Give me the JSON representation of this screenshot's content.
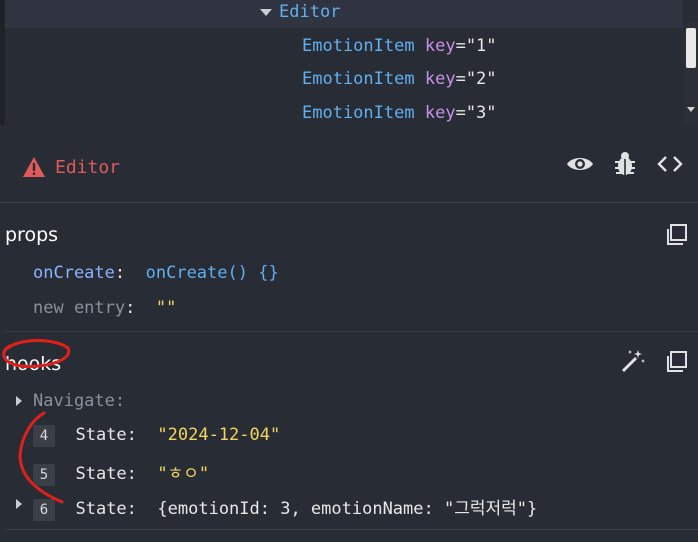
{
  "tree": {
    "parent": "Editor",
    "children": [
      {
        "name": "EmotionItem",
        "key_label": "key",
        "key_value": "\"1\""
      },
      {
        "name": "EmotionItem",
        "key_label": "key",
        "key_value": "\"2\""
      },
      {
        "name": "EmotionItem",
        "key_label": "key",
        "key_value": "\"3\""
      }
    ]
  },
  "selected": {
    "name": "Editor",
    "warning_color": "#e05a5a",
    "icons": [
      "eye-icon",
      "bug-icon",
      "code-icon"
    ]
  },
  "props": {
    "title": "props",
    "rows": [
      {
        "key": "onCreate",
        "sep": ":",
        "value": "onCreate() {}"
      },
      {
        "key": "new entry",
        "sep": ":",
        "value": "\"\""
      }
    ]
  },
  "hooks": {
    "title": "hooks",
    "rows": [
      {
        "index": "",
        "label": "Navigate",
        "sep": ":",
        "value": ""
      },
      {
        "index": "4",
        "label": "State",
        "sep": ":",
        "value": "\"2024-12-04\""
      },
      {
        "index": "5",
        "label": "State",
        "sep": ":",
        "value": "\"ㅎㅇ\""
      },
      {
        "index": "6",
        "label": "State",
        "sep": ":",
        "value_open": "{emotionId: 3, emotionName: ",
        "value_str": "\"그럭저럭\"",
        "value_close": "}"
      }
    ]
  },
  "annotation_color": "#e0201b"
}
